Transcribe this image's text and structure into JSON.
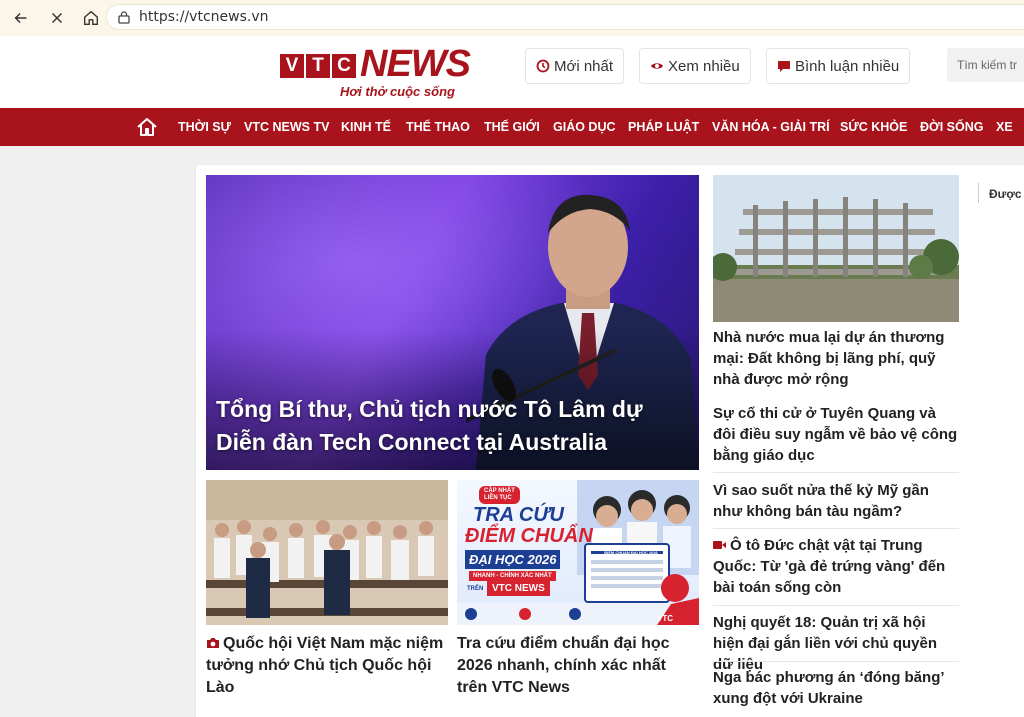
{
  "browser": {
    "url": "https://vtcnews.vn"
  },
  "header": {
    "logo_letters": [
      "V",
      "T",
      "C"
    ],
    "logo_news": "NEWS",
    "logo_slogan": "Hơi thở cuộc sống",
    "buttons": [
      {
        "label": "Mới nhất",
        "icon": "clock-icon"
      },
      {
        "label": "Xem nhiều",
        "icon": "eye-icon"
      },
      {
        "label": "Bình luận nhiều",
        "icon": "chat-icon"
      }
    ],
    "search_placeholder": "Tìm kiếm tr"
  },
  "nav": {
    "items": [
      "THỜI SỰ",
      "VTC NEWS TV",
      "KINH TẾ",
      "THỂ THAO",
      "THẾ GIỚI",
      "GIÁO DỤC",
      "PHÁP LUẬT",
      "VĂN HÓA - GIẢI TRÍ",
      "SỨC KHỎE",
      "ĐỜI SỐNG",
      "XE"
    ]
  },
  "main": {
    "hero_title": "Tổng Bí thư, Chủ tịch nước Tô Lâm dự Diễn đàn Tech Connect tại Australia",
    "story_left_title": "Quốc hội Việt Nam mặc niệm tưởng nhớ Chủ tịch Quốc hội Lào",
    "story_middle_title": "Tra cứu điểm chuẩn đại học 2026 nhanh, chính xác nhất trên VTC News",
    "promo": {
      "tag_line1": "CẬP NHẬT",
      "tag_line2": "LIÊN TỤC",
      "line1": "TRA CỨU",
      "line2": "ĐIỂM CHUẨN",
      "line3": "ĐẠI HỌC 2026",
      "line4": "NHANH - CHÍNH XÁC NHẤT",
      "line5": "TRÊN",
      "brand": "VTC NEWS",
      "screen_title": "ĐIỂM CHUẨN ĐẠI HỌC 2026",
      "corner": "VTC NEWS"
    },
    "side_title_1": "Nhà nước mua lại dự án thương mại: Đất không bị lãng phí, quỹ nhà được mở rộng",
    "side_list": [
      "Sự cố thi cử ở Tuyên Quang và đôi điều suy ngẫm về bảo vệ công bằng giáo dục",
      "Vì sao suốt nửa thế kỷ Mỹ gần như không bán tàu ngầm?",
      "Ô tô Đức chật vật tại Trung Quốc: Từ 'gà đẻ trứng vàng' đến bài toán sống còn",
      "Nghị quyết 18: Quản trị xã hội hiện đại gắn liền với chủ quyền dữ liệu",
      "Nga bác phương án ‘đóng băng’ xung đột với Ukraine"
    ],
    "right_col_label": "Được"
  },
  "colors": {
    "brand_red": "#a8131c",
    "nav_text": "#ffffff"
  }
}
